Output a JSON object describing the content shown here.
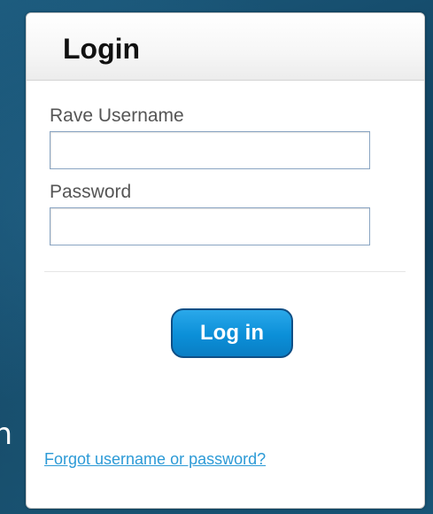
{
  "background": {
    "partial_text": "n"
  },
  "login": {
    "title": "Login",
    "username_label": "Rave Username",
    "username_value": "",
    "password_label": "Password",
    "password_value": "",
    "submit_label": "Log in",
    "forgot_link": "Forgot username or password?"
  },
  "colors": {
    "button": "#0b8fd8",
    "link": "#2c9ad6",
    "background": "#134766"
  }
}
